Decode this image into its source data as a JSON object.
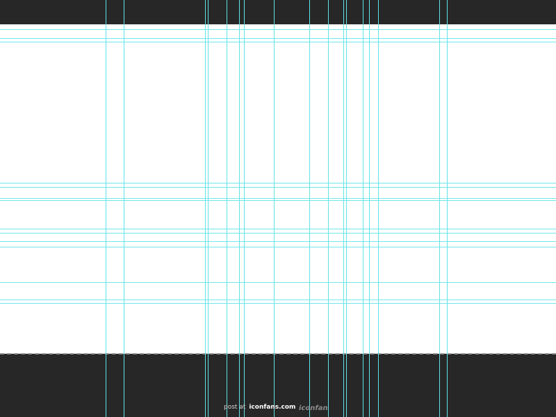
{
  "colors": {
    "background": "#272727",
    "canvas": "#ffffff",
    "guide": "#5fe3e7",
    "canvas_edge": "#9a9a9a"
  },
  "watermark": {
    "prefix": "post at",
    "site": "iconfans.com",
    "logo_text": "iconfans"
  },
  "icons": {
    "logo": "iconfans-logo-icon"
  }
}
